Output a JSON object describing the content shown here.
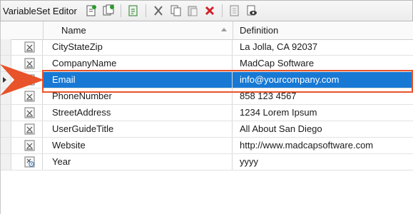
{
  "toolbar": {
    "title": "VariableSet Editor",
    "buttons": [
      {
        "icon": "add-variable-icon"
      },
      {
        "icon": "add-multiple-icon"
      },
      {
        "icon": "add-definition-icon"
      },
      {
        "icon": "cut-icon"
      },
      {
        "icon": "copy-icon"
      },
      {
        "icon": "paste-icon"
      },
      {
        "icon": "delete-icon"
      },
      {
        "icon": "properties-icon"
      },
      {
        "icon": "preview-icon"
      }
    ]
  },
  "columns": {
    "name": "Name",
    "definition": "Definition"
  },
  "rows": [
    {
      "name": "CityStateZip",
      "definition": "La Jolla, CA 92037"
    },
    {
      "name": "CompanyName",
      "definition": "MadCap Software"
    },
    {
      "name": "Email",
      "definition": "info@yourcompany.com"
    },
    {
      "name": "PhoneNumber",
      "definition": "858 123 4567"
    },
    {
      "name": "StreetAddress",
      "definition": "1234 Lorem Ipsum"
    },
    {
      "name": "UserGuideTitle",
      "definition": "All About San Diego"
    },
    {
      "name": "Website",
      "definition": "http://www.madcapsoftware.com"
    },
    {
      "name": "Year",
      "definition": "yyyy"
    }
  ],
  "selected_row": "Email",
  "colors": {
    "selection": "#1779d4",
    "callout": "#e8532a"
  }
}
